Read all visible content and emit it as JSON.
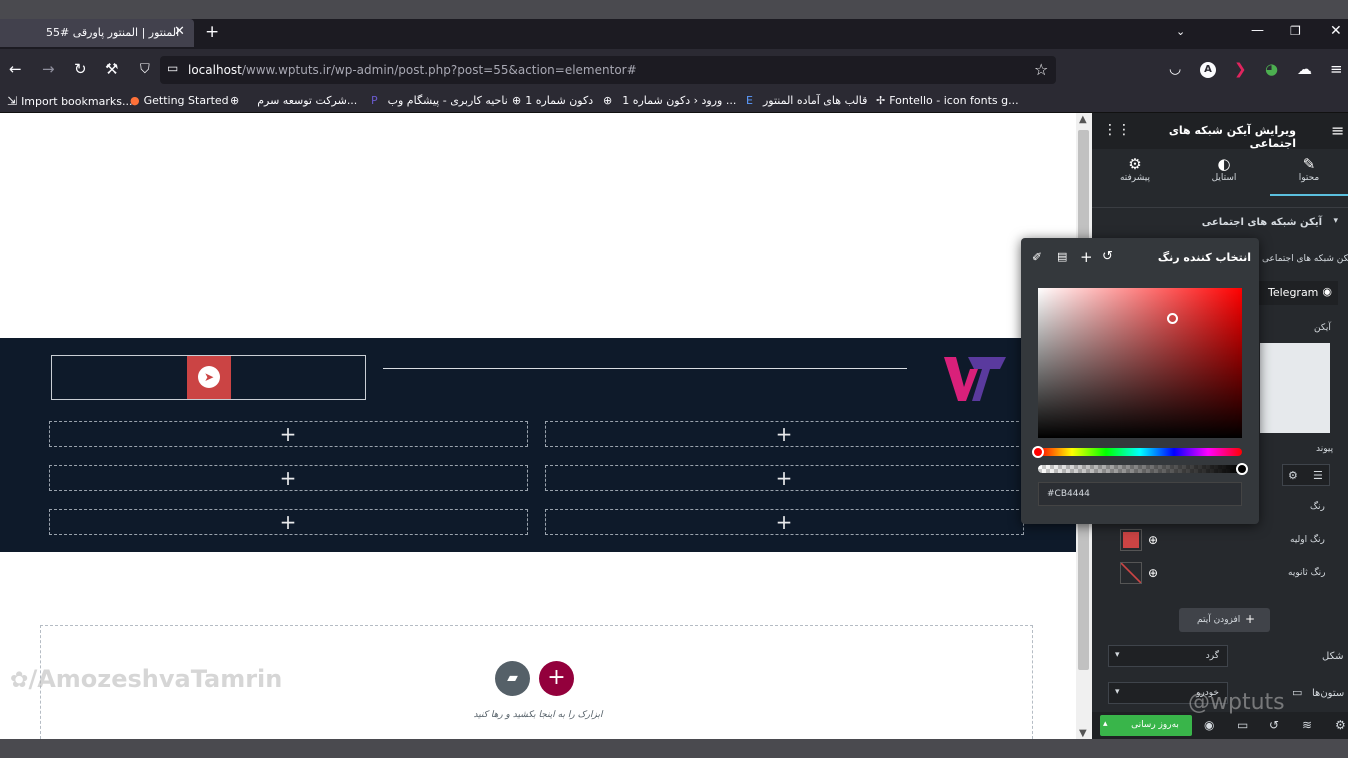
{
  "browser": {
    "tab_title": "المنتور | المنتور پاورقی #55",
    "url_host": "localhost",
    "url_path": "/www.wptuts.ir/wp-admin/post.php?post=55&action=elementor#",
    "bookmarks": [
      "Import bookmarks...",
      "Getting Started",
      "شرکت توسعه سرم...",
      "ناحیه کاربری - پیشگام وب",
      "دکون شماره 1",
      "ورود ‹ دکون شماره 1 ...",
      "قالب های آماده المنتور",
      "Fontello - icon fonts g..."
    ]
  },
  "canvas": {
    "drop_hint": "ابزارک را به اینجا بکشید و رها کنید"
  },
  "watermark": {
    "left": "/AmozeshvaTamrin",
    "right": "@wptuts"
  },
  "panel": {
    "title": "ویرایش آیکن شبکه های اجتماعی",
    "tabs": [
      "محتوا",
      "استایل",
      "پیشرفته"
    ],
    "section_title": "آیکن شبکه های اجتماعی",
    "repeater_label": "آیکن شبکه های اجتماعی",
    "item_label": "Telegram",
    "icon_label": "آیکن",
    "link_label": "پیوند",
    "color_label": "رنگ",
    "primary_color_label": "رنگ اولیه",
    "secondary_color_label": "رنگ ثانویه",
    "add_item": "افزودن آیتم",
    "shape_label": "شکل",
    "shape_value": "گرد",
    "columns_label": "ستون‌ها",
    "columns_value": "خودرو",
    "update_button": "به‌روز رسانی"
  },
  "picker": {
    "title": "انتخاب کننده رنگ",
    "hex": "#CB4444"
  },
  "colors": {
    "accent": "#CB4444",
    "dark_section": "#0e1a2a",
    "update_green": "#39b54a",
    "fab_red": "#93003c"
  }
}
